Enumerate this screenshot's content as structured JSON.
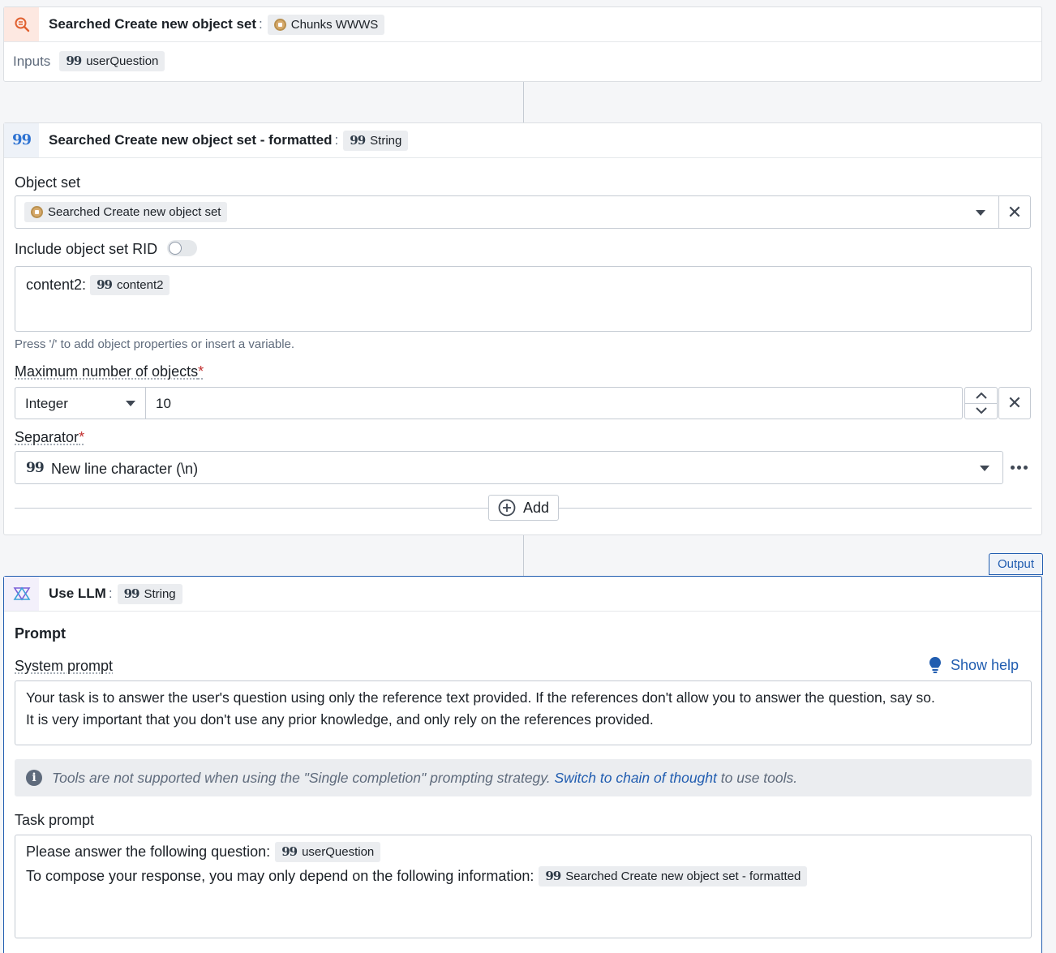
{
  "card1": {
    "title": "Searched Create new object set",
    "type_chip": "Chunks WWWS",
    "inputs_label": "Inputs",
    "input_chip": "userQuestion"
  },
  "card2": {
    "title": "Searched Create new object set - formatted",
    "type_chip": "String",
    "object_set_label": "Object set",
    "object_set_value": "Searched Create new object set",
    "include_rid_label": "Include object set RID",
    "include_rid_on": false,
    "template_key": "content2:",
    "template_chip": "content2",
    "template_hint": "Press '/' to add object properties or insert a variable.",
    "max_objects_label": "Maximum number of objects",
    "max_type": "Integer",
    "max_value": "10",
    "separator_label": "Separator",
    "separator_value": "New line character (\\n)",
    "add_label": "Add",
    "required_mark": "*"
  },
  "card3": {
    "output_tag": "Output",
    "title": "Use LLM",
    "type_chip": "String",
    "prompt_heading": "Prompt",
    "system_prompt_label": "System prompt",
    "show_help": "Show help",
    "system_prompt_line1": "Your task is to answer the user's question using only the reference text provided. If the references don't allow you to answer the question, say so.",
    "system_prompt_line2": "It is very important that you don't use any prior knowledge, and only rely on the references provided.",
    "tools_notice_pre": "Tools are not supported when using the \"Single completion\" prompting strategy.",
    "tools_notice_link": "Switch to chain of thought",
    "tools_notice_post": "to use tools.",
    "task_prompt_label": "Task prompt",
    "task_line1_text": "Please answer the following question:",
    "task_line1_chip": "userQuestion",
    "task_line2_text": "To compose your response, you may only depend on the following information:",
    "task_line2_chip": "Searched Create new object set - formatted"
  },
  "colors": {
    "accent": "#215db0",
    "search_icon": "#e0602f",
    "quote_icon": "#2d72d2",
    "required": "#c23030"
  },
  "icons": [
    "search-doc-icon",
    "quote-icon",
    "object-type-icon",
    "llm-icon",
    "close-icon",
    "chevron-down-icon",
    "chevron-up-icon",
    "more-icon",
    "add-circle-icon",
    "lightbulb-icon",
    "info-icon"
  ]
}
